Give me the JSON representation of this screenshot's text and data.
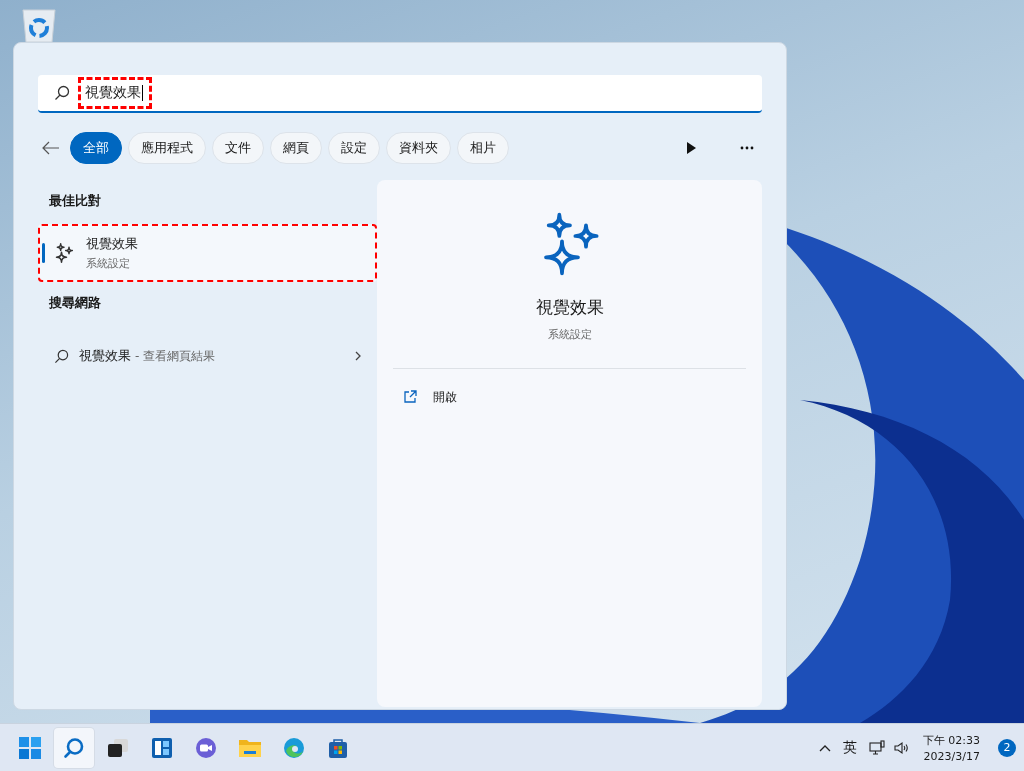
{
  "search": {
    "value": "視覺效果",
    "annotated": true
  },
  "filters": [
    {
      "label": "全部",
      "selected": true
    },
    {
      "label": "應用程式",
      "selected": false
    },
    {
      "label": "文件",
      "selected": false
    },
    {
      "label": "網頁",
      "selected": false
    },
    {
      "label": "設定",
      "selected": false
    },
    {
      "label": "資料夾",
      "selected": false
    },
    {
      "label": "相片",
      "selected": false
    }
  ],
  "best_match": {
    "heading": "最佳比對",
    "title": "視覺效果",
    "subtitle": "系統設定",
    "selected": true,
    "annotated": true
  },
  "web": {
    "heading": "搜尋網路",
    "query": "視覺效果",
    "suffix": "- 查看網頁結果"
  },
  "detail": {
    "title": "視覺效果",
    "subtitle": "系統設定",
    "actions": [
      {
        "label": "開啟"
      }
    ]
  },
  "taskbar": {
    "apps": [
      {
        "kind": "start",
        "selected": false
      },
      {
        "kind": "search",
        "selected": true
      },
      {
        "kind": "taskview",
        "selected": false
      },
      {
        "kind": "widgets",
        "selected": false
      },
      {
        "kind": "chat",
        "selected": false
      },
      {
        "kind": "explorer",
        "selected": false
      },
      {
        "kind": "edge",
        "selected": false
      },
      {
        "kind": "store",
        "selected": false
      }
    ],
    "ime": "英",
    "time": "下午 02:33",
    "date": "2023/3/17",
    "badge": "2"
  }
}
